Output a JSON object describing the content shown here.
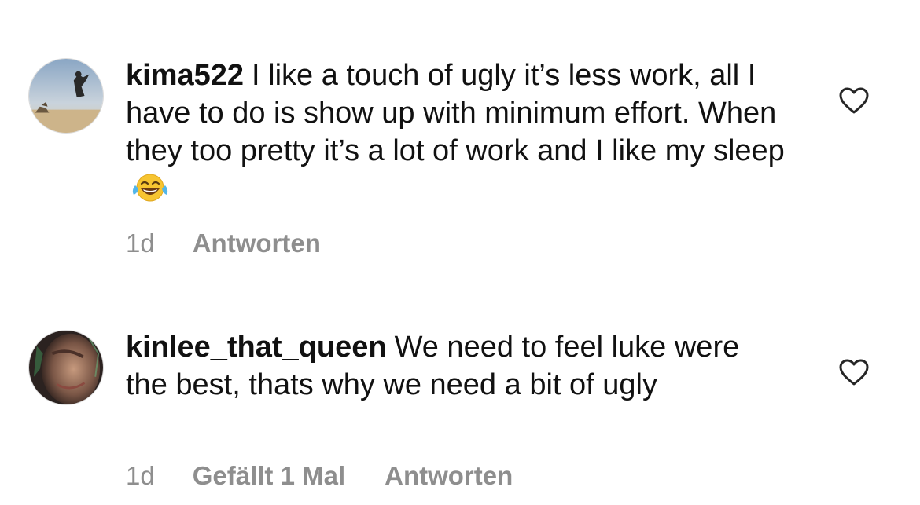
{
  "comments": [
    {
      "username": "kima522",
      "text": "I like a touch of ugly it’s less work, all I have to do is show up with minimum effort. When they too pretty it’s a lot of work and I like my sleep",
      "emoji": "face-with-tears-of-joy",
      "time": "1d",
      "reply_label": "Antworten",
      "avatar": "desert-jumping-photo",
      "like_icon": "heart-outline-icon"
    },
    {
      "username": "kinlee_that_queen",
      "text": "We need to feel luke were the best, thats why we need a bit of ugly",
      "time": "1d",
      "likes_label": "Gefällt 1 Mal",
      "reply_label": "Antworten",
      "avatar": "dark-selfie-photo",
      "like_icon": "heart-outline-icon"
    }
  ],
  "colors": {
    "text": "#111111",
    "meta": "#8e8e8e",
    "icon": "#262626"
  }
}
